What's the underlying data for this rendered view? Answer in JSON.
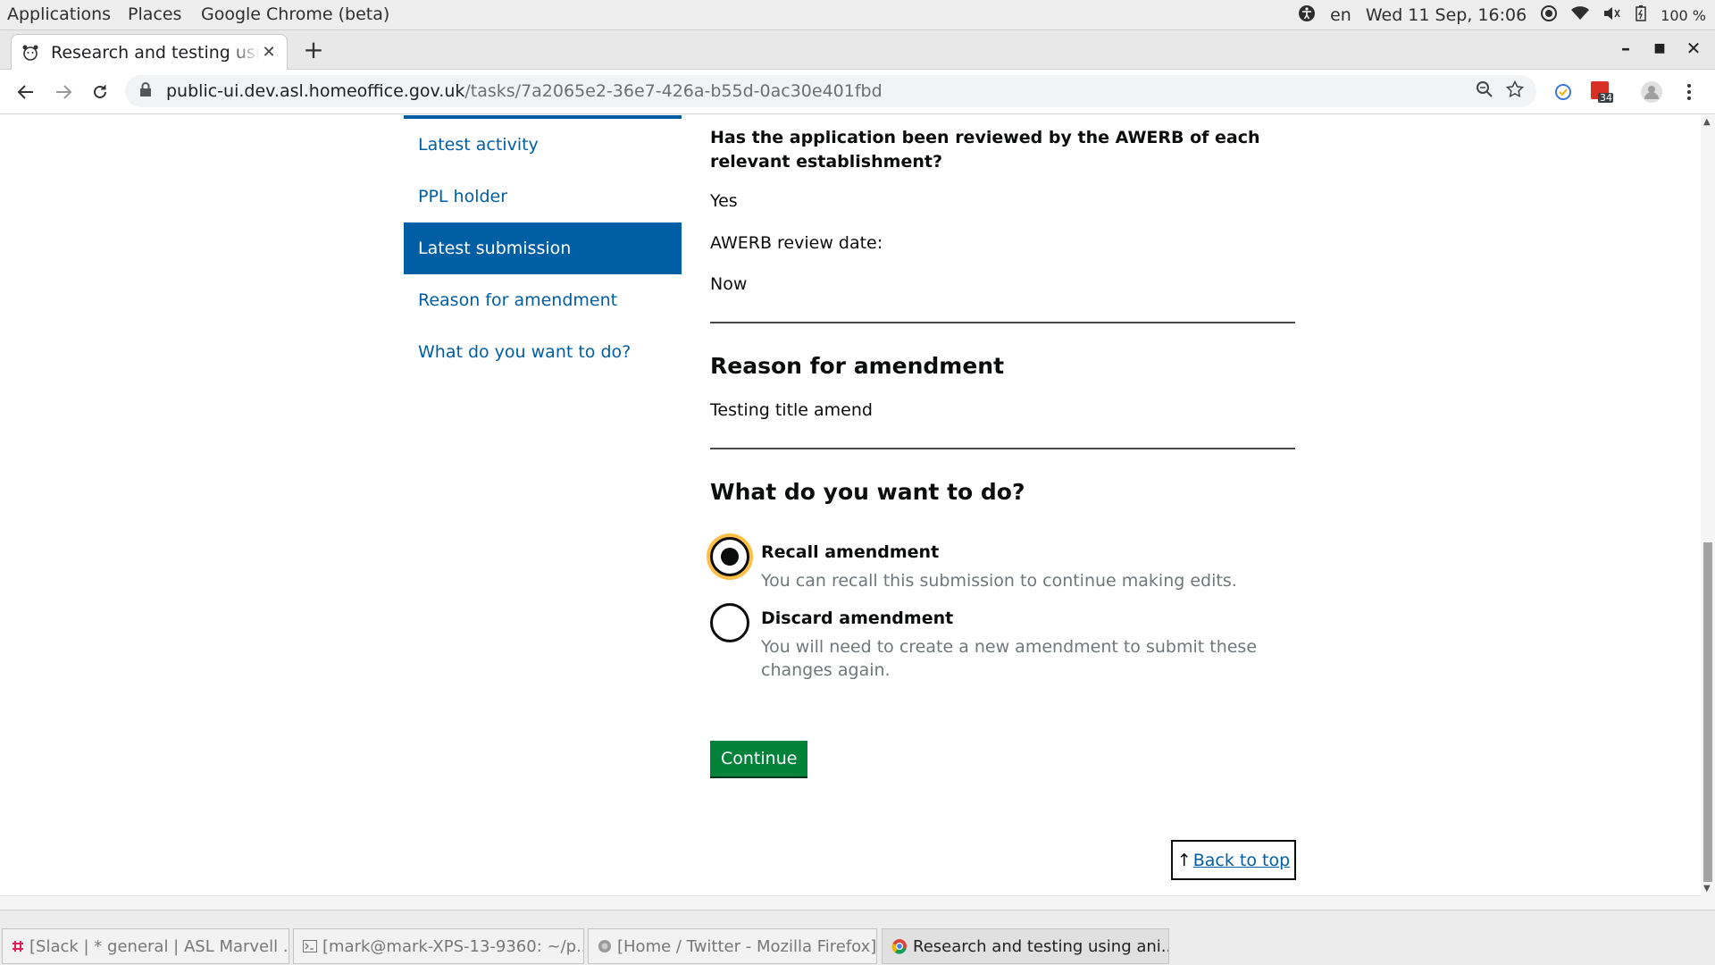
{
  "system_bar": {
    "menus": [
      "Applications",
      "Places",
      "Google Chrome (beta)"
    ],
    "language": "en",
    "datetime": "Wed 11 Sep, 16:06",
    "battery": "100 %"
  },
  "browser": {
    "tab_title": "Research and testing using ani",
    "url_host": "public-ui.dev.asl.homeoffice.gov.uk",
    "url_path": "/tasks/7a2065e2-36e7-426a-b55d-0ac30e401fbd",
    "extension_badge": "34",
    "icons": {
      "back": "back-arrow-icon",
      "forward": "forward-arrow-icon",
      "reload": "reload-icon",
      "lock": "lock-icon",
      "zoom": "zoom-icon",
      "bookmark": "star-icon",
      "profile": "profile-icon",
      "menu": "kebab-menu-icon"
    }
  },
  "sidebar": {
    "items": [
      {
        "label": "Latest activity",
        "active": false
      },
      {
        "label": "PPL holder",
        "active": false
      },
      {
        "label": "Latest submission",
        "active": true
      },
      {
        "label": "Reason for amendment",
        "active": false
      },
      {
        "label": "What do you want to do?",
        "active": false
      }
    ]
  },
  "content": {
    "awerb_question": "Has the application been reviewed by the AWERB of each relevant establishment?",
    "awerb_answer": "Yes",
    "awerb_date_label": "AWERB review date:",
    "awerb_date_value": "Now",
    "reason_heading": "Reason for amendment",
    "reason_text": "Testing title amend",
    "action_heading": "What do you want to do?",
    "options": [
      {
        "label": "Recall amendment",
        "hint": "You can recall this submission to continue making edits.",
        "checked": true
      },
      {
        "label": "Discard amendment",
        "hint": "You will need to create a new amendment to submit these changes again.",
        "checked": false
      }
    ],
    "continue_label": "Continue",
    "back_to_top": "Back to top"
  },
  "colors": {
    "link_blue": "#005ea5",
    "button_green": "#00823b",
    "focus_yellow": "#ffbf47"
  },
  "taskbar": {
    "items": [
      {
        "label": "[Slack | * general | ASL Marvell ...",
        "active": false
      },
      {
        "label": "[mark@mark-XPS-13-9360: ~/p...",
        "active": false
      },
      {
        "label": "[Home / Twitter - Mozilla Firefox]",
        "active": false
      },
      {
        "label": "Research and testing using ani...",
        "active": true
      }
    ]
  }
}
